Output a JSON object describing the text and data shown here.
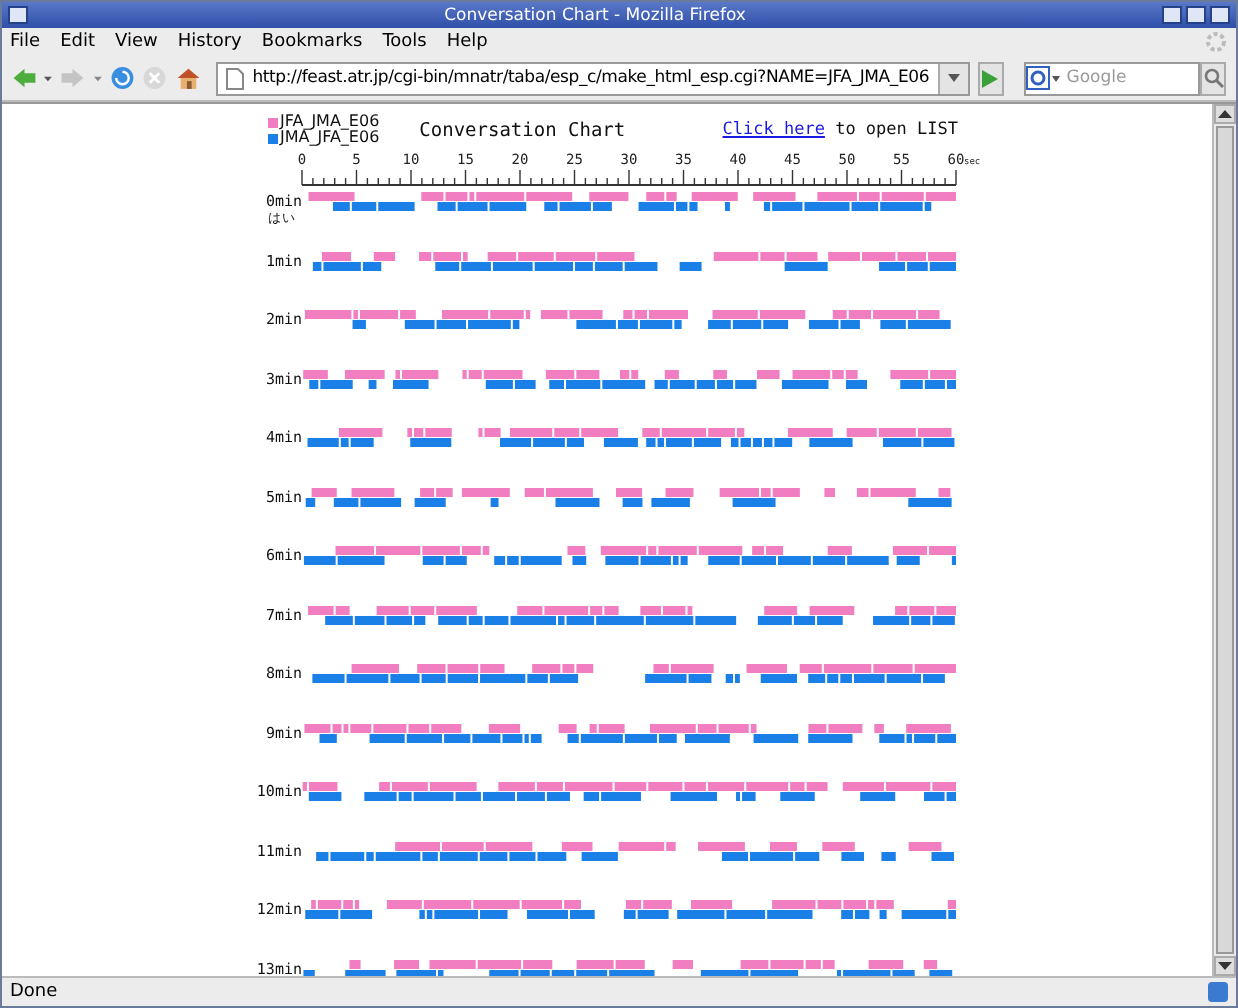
{
  "window": {
    "title": "Conversation Chart - Mozilla Firefox"
  },
  "menu": [
    "File",
    "Edit",
    "View",
    "History",
    "Bookmarks",
    "Tools",
    "Help"
  ],
  "address": {
    "value": "http://feast.atr.jp/cgi-bin/mnatr/taba/esp_c/make_html_esp.cgi?NAME=JFA_JMA_E06"
  },
  "search": {
    "placeholder": "Google"
  },
  "legend": [
    {
      "label": "JFA_JMA_E06",
      "color": "#f07ec0"
    },
    {
      "label": "JMA_JFA_E06",
      "color": "#1a7fe6"
    }
  ],
  "chart_title": "Conversation Chart",
  "link": {
    "text": "Click here",
    "after": "to open LIST"
  },
  "axis": {
    "ticks": [
      "0",
      "5",
      "10",
      "15",
      "20",
      "25",
      "30",
      "35",
      "40",
      "45",
      "50",
      "55",
      "60"
    ],
    "unit": "sec"
  },
  "rows": [
    {
      "label": "0min",
      "note": "はい"
    },
    {
      "label": "1min"
    },
    {
      "label": "2min"
    },
    {
      "label": "3min"
    },
    {
      "label": "4min"
    },
    {
      "label": "5min"
    },
    {
      "label": "6min"
    },
    {
      "label": "7min"
    },
    {
      "label": "8min"
    },
    {
      "label": "9min"
    },
    {
      "label": "10min"
    },
    {
      "label": "11min"
    },
    {
      "label": "12min"
    },
    {
      "label": "13min"
    }
  ],
  "status": "Done"
}
